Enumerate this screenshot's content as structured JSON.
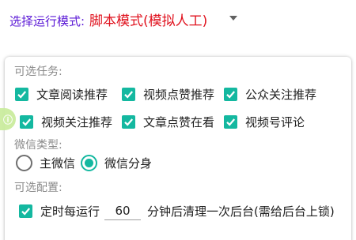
{
  "mode": {
    "label": "选择运行模式:",
    "value": "脚本模式(模拟人工)",
    "label_color": "#5b19d6",
    "value_color": "#e0121e",
    "arrow_icon": "dropdown-arrow-icon"
  },
  "tasks": {
    "title": "可选任务:",
    "items": [
      {
        "label": "文章阅读推荐",
        "checked": true
      },
      {
        "label": "视频点赞推荐",
        "checked": true
      },
      {
        "label": "公众关注推荐",
        "checked": true
      },
      {
        "label": "视频关注推荐",
        "checked": true
      },
      {
        "label": "文章点赞在看",
        "checked": true
      },
      {
        "label": "视频号评论",
        "checked": true
      }
    ]
  },
  "wechat_type": {
    "title": "微信类型:",
    "options": [
      {
        "label": "主微信",
        "selected": false
      },
      {
        "label": "微信分身",
        "selected": true
      }
    ]
  },
  "config": {
    "title": "可选配置:",
    "interval_checked": true,
    "interval_prefix": "定时每运行",
    "interval_value": "60",
    "interval_suffix": "分钟后清理一次后台(需给后台上锁)"
  },
  "accent_color": "#14b8a0",
  "floating_badge": {
    "glyph": "ⓘ"
  }
}
